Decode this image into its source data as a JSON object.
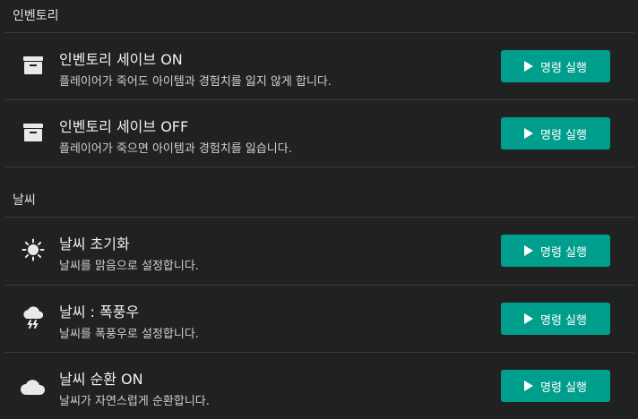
{
  "sections": [
    {
      "header": "인벤토리",
      "items": [
        {
          "title": "인벤토리 세이브 ON",
          "desc": "플레이어가 죽어도 아이템과 경험치를 잃지 않게 합니다.",
          "icon": "archive-icon",
          "button": "명령 실행"
        },
        {
          "title": "인벤토리 세이브 OFF",
          "desc": "플레이어가 죽으면 아이템과 경험치를 잃습니다.",
          "icon": "archive-icon",
          "button": "명령 실행"
        }
      ]
    },
    {
      "header": "날씨",
      "items": [
        {
          "title": "날씨 초기화",
          "desc": "날씨를 맑음으로 설정합니다.",
          "icon": "sun-icon",
          "button": "명령 실행"
        },
        {
          "title": "날씨 : 폭풍우",
          "desc": "날씨를 폭풍우로 설정합니다.",
          "icon": "storm-icon",
          "button": "명령 실행"
        },
        {
          "title": "날씨 순환 ON",
          "desc": "날씨가 자연스럽게 순환합니다.",
          "icon": "cloud-icon",
          "button": "명령 실행"
        }
      ]
    }
  ],
  "colors": {
    "background": "#202221",
    "accent": "#009e8c",
    "divider": "#3a3c3b"
  }
}
